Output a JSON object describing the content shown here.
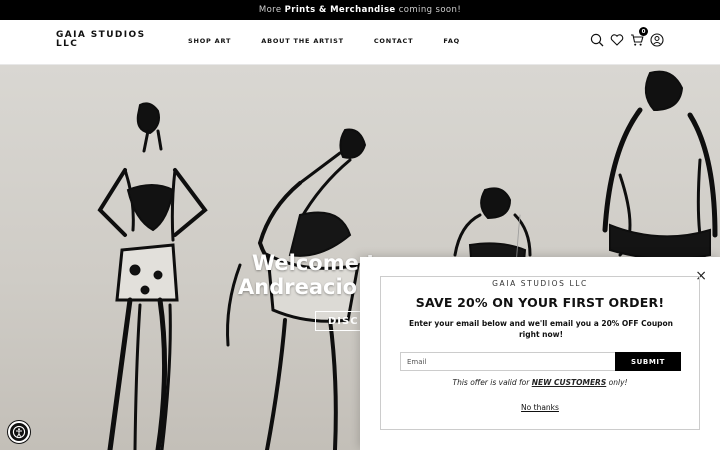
{
  "announcement": {
    "prefix": "More",
    "highlight": "Prints & Merchandise",
    "suffix": "coming soon!"
  },
  "header": {
    "logo": "GAIA STUDIOS LLC",
    "nav": [
      "SHOP ART",
      "ABOUT THE ARTIST",
      "CONTACT",
      "FAQ"
    ],
    "cart_count": "0",
    "icons": [
      "search-icon",
      "heart-icon",
      "cart-icon",
      "account-icon"
    ]
  },
  "hero": {
    "title_line1": "Welcome t",
    "title_line2": "Andreacio",
    "button": "DISC"
  },
  "popup": {
    "brand": "GAIA STUDIOS LLC",
    "title": "SAVE 20% ON YOUR FIRST ORDER!",
    "text": "Enter your email below and we'll email you a 20% OFF Coupon right now!",
    "email_placeholder": "Email",
    "submit": "SUBMIT",
    "offer_prefix": "This offer is valid for",
    "offer_highlight": "NEW CUSTOMERS",
    "offer_suffix": "only!",
    "no_thanks": "No thanks",
    "close": "×"
  },
  "colors": {
    "announcement_bg": "#000000",
    "submit_bg": "#000000",
    "hero_bg": "#d6d4cf"
  }
}
